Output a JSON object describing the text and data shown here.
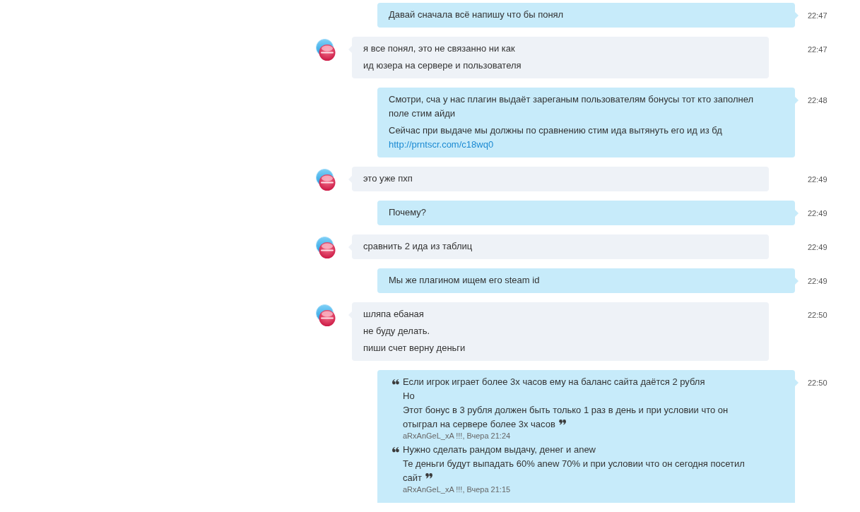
{
  "messages": [
    {
      "kind": "outgoing",
      "time": "22:47",
      "paragraphs": [
        {
          "text": "Давай сначала всё напишу что бы понял"
        }
      ]
    },
    {
      "kind": "incoming",
      "time": "22:47",
      "paragraphs": [
        {
          "text": "я все понял, это не связанно ни как"
        },
        {
          "text": "ид юзера на сервере и пользователя"
        }
      ]
    },
    {
      "kind": "outgoing",
      "time": "22:48",
      "paragraphs": [
        {
          "text": "Смотри, сча у нас плагин выдаёт зареганым пользователям бонусы тот кто заполнел поле стим айди"
        },
        {
          "text": "Сейчас при выдаче мы должны по сравнению стим ида вытянуть его ид из бд",
          "link": "http://prntscr.com/c18wq0"
        }
      ]
    },
    {
      "kind": "incoming",
      "time": "22:49",
      "paragraphs": [
        {
          "text": "это уже пхп"
        }
      ]
    },
    {
      "kind": "outgoing",
      "time": "22:49",
      "paragraphs": [
        {
          "text": "Почему?"
        }
      ]
    },
    {
      "kind": "incoming",
      "time": "22:49",
      "paragraphs": [
        {
          "text": "сравнить 2 ида из таблиц"
        }
      ]
    },
    {
      "kind": "outgoing",
      "time": "22:49",
      "paragraphs": [
        {
          "text": "Мы же плагином ищем его steam id"
        }
      ]
    },
    {
      "kind": "incoming",
      "time": "22:50",
      "paragraphs": [
        {
          "text": "шляпа ебаная"
        },
        {
          "text": "не буду делать."
        },
        {
          "text": "пиши счет верну деньги"
        }
      ]
    },
    {
      "kind": "outgoing",
      "time": "22:50",
      "quotes": [
        {
          "lines": [
            "Если игрок играет более 3х часов ему на баланс сайта даётся 2 рубля",
            "Но",
            "Этот бонус в 3 рубля должен быть только 1 раз в день и при условии что он",
            "отыграл на сервере более 3х часов"
          ],
          "author": "aRxAnGeL_xA !!!, Вчера 21:24"
        },
        {
          "lines": [
            "Нужно сделать рандом выдачу, денег и anew",
            "Те деньги будут выпадать 60% anew 70% и при условии что он сегодня посетил",
            "сайт"
          ],
          "author": "aRxAnGeL_xA !!!, Вчера 21:15"
        }
      ]
    }
  ]
}
